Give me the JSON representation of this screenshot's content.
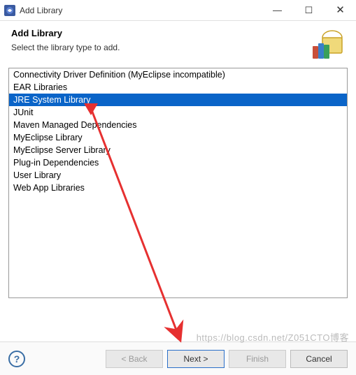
{
  "window": {
    "title": "Add Library",
    "minimize": "—",
    "maximize": "☐",
    "close": "✕"
  },
  "header": {
    "title": "Add Library",
    "subtitle": "Select the library type to add."
  },
  "list": {
    "items": [
      {
        "label": "Connectivity Driver Definition (MyEclipse incompatible)",
        "selected": false
      },
      {
        "label": "EAR Libraries",
        "selected": false
      },
      {
        "label": "JRE System Library",
        "selected": true
      },
      {
        "label": "JUnit",
        "selected": false
      },
      {
        "label": "Maven Managed Dependencies",
        "selected": false
      },
      {
        "label": "MyEclipse Library",
        "selected": false
      },
      {
        "label": "MyEclipse Server Library",
        "selected": false
      },
      {
        "label": "Plug-in Dependencies",
        "selected": false
      },
      {
        "label": "User Library",
        "selected": false
      },
      {
        "label": "Web App Libraries",
        "selected": false
      }
    ]
  },
  "buttons": {
    "help": "?",
    "back": "< Back",
    "next": "Next >",
    "finish": "Finish",
    "cancel": "Cancel"
  },
  "watermark": "https://blog.csdn.net/Z051CTO博客"
}
